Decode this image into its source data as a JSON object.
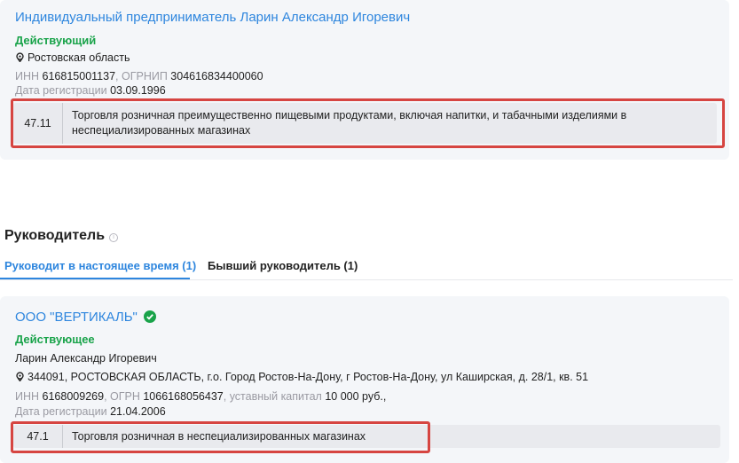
{
  "entrepreneur": {
    "name": "Индивидуальный предприниматель Ларин Александр Игоревич",
    "status": "Действующий",
    "region": "Ростовская область",
    "inn_label": "ИНН",
    "inn": "616815001137",
    "ogrnip_label": "ОГРНИП",
    "ogrnip": "304616834400060",
    "reg_label": "Дата регистрации",
    "reg_date": "03.09.1996",
    "okved_code": "47.11",
    "okved_desc": "Торговля розничная преимущественно пищевыми продуктами, включая напитки, и табачными изделиями в неспециализированных магазинах"
  },
  "leader_section": {
    "title": "Руководитель",
    "tabs": [
      {
        "label": "Руководит в настоящее время (1)",
        "active": true
      },
      {
        "label": "Бывший руководитель (1)",
        "active": false
      }
    ]
  },
  "company": {
    "name": "ООО \"ВЕРТИКАЛЬ\"",
    "status": "Действующее",
    "leader": "Ларин Александр Игоревич",
    "address": "344091, РОСТОВСКАЯ ОБЛАСТЬ, г.о. Город Ростов-На-Дону, г Ростов-На-Дону, ул Каширская, д. 28/1, кв. 51",
    "inn_label": "ИНН",
    "inn": "6168009269",
    "ogrn_label": "ОГРН",
    "ogrn": "1066168056437",
    "capital_label": "уставный капитал",
    "capital": "10 000 руб.",
    "reg_label": "Дата регистрации",
    "reg_date": "21.04.2006",
    "okved_code": "47.1",
    "okved_desc": "Торговля розничная в неспециализированных магазинах"
  },
  "colors": {
    "link": "#2e86de",
    "status_green": "#19a34a",
    "highlight_red": "#d64541"
  }
}
